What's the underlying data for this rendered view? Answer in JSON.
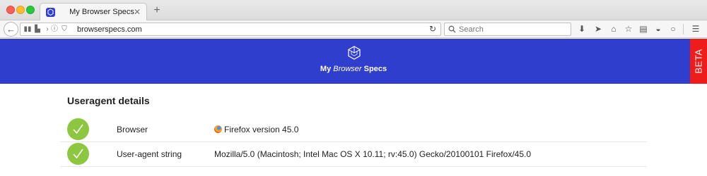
{
  "browser": {
    "tab_title": "My Browser Specs",
    "tab_close": "✕",
    "new_tab": "+",
    "url": "browserspecs.com",
    "search_placeholder": "Search"
  },
  "site": {
    "brand_my": "My",
    "brand_browser": "Browser",
    "brand_specs": "Specs",
    "beta_label": "BETA",
    "header_color": "#2f3ecd",
    "beta_color": "#ef1c1c"
  },
  "content": {
    "section_title": "Useragent details",
    "rows": [
      {
        "label": "Browser",
        "value": "Firefox version 45.0",
        "icon": "firefox-icon",
        "status": "ok"
      },
      {
        "label": "User-agent string",
        "value": "Mozilla/5.0 (Macintosh; Intel Mac OS X 10.11; rv:45.0) Gecko/20100101 Firefox/45.0",
        "status": "ok"
      }
    ],
    "check_color": "#8dc63f"
  }
}
